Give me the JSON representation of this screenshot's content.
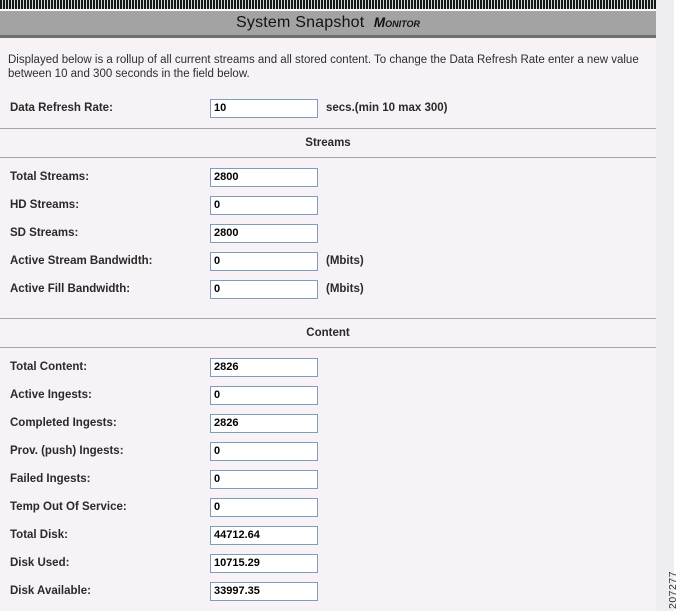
{
  "header": {
    "title": "System Snapshot",
    "mode_label": "Monitor"
  },
  "intro": "Displayed below is a rollup of all current streams and all stored content. To change the Data Refresh Rate enter a new value between 10 and 300 seconds in the field below.",
  "refresh_rate": {
    "label": "Data Refresh Rate:",
    "value": "10",
    "suffix": "secs.(min 10 max 300)"
  },
  "sections": [
    {
      "header": "Streams",
      "rows": [
        {
          "label": "Total Streams:",
          "value": "2800",
          "suffix": ""
        },
        {
          "label": "HD Streams:",
          "value": "0",
          "suffix": ""
        },
        {
          "label": "SD Streams:",
          "value": "2800",
          "suffix": ""
        },
        {
          "label": "Active Stream Bandwidth:",
          "value": "0",
          "suffix": "(Mbits)"
        },
        {
          "label": "Active Fill Bandwidth:",
          "value": "0",
          "suffix": "(Mbits)"
        }
      ]
    },
    {
      "header": "Content",
      "rows": [
        {
          "label": "Total Content:",
          "value": "2826",
          "suffix": ""
        },
        {
          "label": "Active Ingests:",
          "value": "0",
          "suffix": ""
        },
        {
          "label": "Completed Ingests:",
          "value": "2826",
          "suffix": ""
        },
        {
          "label": "Prov. (push) Ingests:",
          "value": "0",
          "suffix": ""
        },
        {
          "label": "Failed Ingests:",
          "value": "0",
          "suffix": ""
        },
        {
          "label": "Temp Out Of Service:",
          "value": "0",
          "suffix": ""
        },
        {
          "label": "Total Disk:",
          "value": "44712.64",
          "suffix": ""
        },
        {
          "label": "Disk Used:",
          "value": "10715.29",
          "suffix": ""
        },
        {
          "label": "Disk Available:",
          "value": "33997.35",
          "suffix": ""
        }
      ]
    }
  ],
  "figure_number": "207277",
  "colors": {
    "title_bar": "#a3a3a3",
    "title_bar_border": "#6e6e6e",
    "body_bg": "#f6f2f5",
    "input_border": "#7f9db9",
    "rule": "#a6a6a6",
    "stripe_dark": "#16181a",
    "stripe_light": "#ccdcd8",
    "right_strip": "#eeedef"
  }
}
